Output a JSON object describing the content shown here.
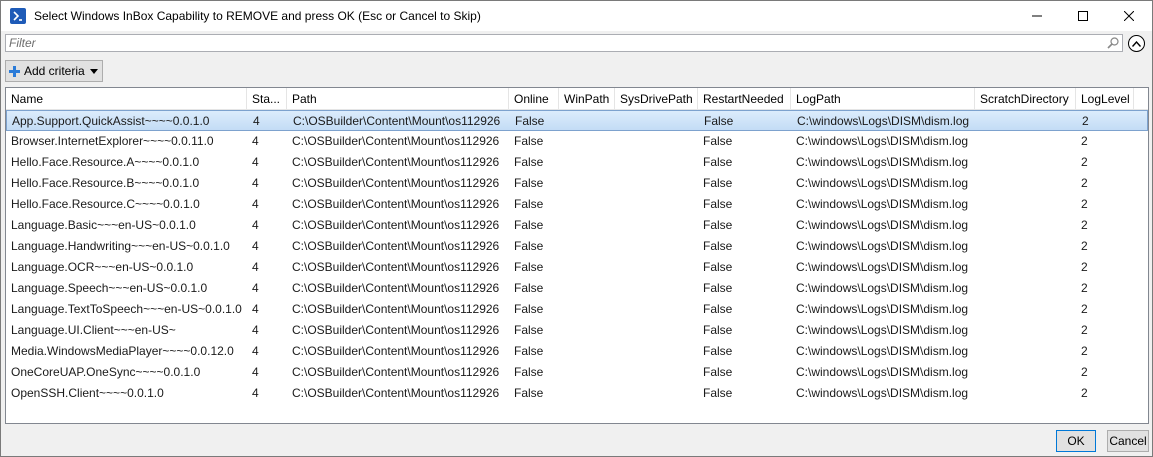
{
  "window": {
    "title": "Select Windows InBox Capability to REMOVE and press OK (Esc or Cancel to Skip)"
  },
  "filter": {
    "placeholder": "Filter"
  },
  "toolbar": {
    "add_criteria_label": "Add criteria"
  },
  "columns": [
    "Name",
    "Sta...",
    "Path",
    "Online",
    "WinPath",
    "SysDrivePath",
    "RestartNeeded",
    "LogPath",
    "ScratchDirectory",
    "LogLevel"
  ],
  "rows": [
    [
      "App.Support.QuickAssist~~~~0.0.1.0",
      "4",
      "C:\\OSBuilder\\Content\\Mount\\os112926",
      "False",
      "",
      "",
      "False",
      "C:\\windows\\Logs\\DISM\\dism.log",
      "",
      "2"
    ],
    [
      "Browser.InternetExplorer~~~~0.0.11.0",
      "4",
      "C:\\OSBuilder\\Content\\Mount\\os112926",
      "False",
      "",
      "",
      "False",
      "C:\\windows\\Logs\\DISM\\dism.log",
      "",
      "2"
    ],
    [
      "Hello.Face.Resource.A~~~~0.0.1.0",
      "4",
      "C:\\OSBuilder\\Content\\Mount\\os112926",
      "False",
      "",
      "",
      "False",
      "C:\\windows\\Logs\\DISM\\dism.log",
      "",
      "2"
    ],
    [
      "Hello.Face.Resource.B~~~~0.0.1.0",
      "4",
      "C:\\OSBuilder\\Content\\Mount\\os112926",
      "False",
      "",
      "",
      "False",
      "C:\\windows\\Logs\\DISM\\dism.log",
      "",
      "2"
    ],
    [
      "Hello.Face.Resource.C~~~~0.0.1.0",
      "4",
      "C:\\OSBuilder\\Content\\Mount\\os112926",
      "False",
      "",
      "",
      "False",
      "C:\\windows\\Logs\\DISM\\dism.log",
      "",
      "2"
    ],
    [
      "Language.Basic~~~en-US~0.0.1.0",
      "4",
      "C:\\OSBuilder\\Content\\Mount\\os112926",
      "False",
      "",
      "",
      "False",
      "C:\\windows\\Logs\\DISM\\dism.log",
      "",
      "2"
    ],
    [
      "Language.Handwriting~~~en-US~0.0.1.0",
      "4",
      "C:\\OSBuilder\\Content\\Mount\\os112926",
      "False",
      "",
      "",
      "False",
      "C:\\windows\\Logs\\DISM\\dism.log",
      "",
      "2"
    ],
    [
      "Language.OCR~~~en-US~0.0.1.0",
      "4",
      "C:\\OSBuilder\\Content\\Mount\\os112926",
      "False",
      "",
      "",
      "False",
      "C:\\windows\\Logs\\DISM\\dism.log",
      "",
      "2"
    ],
    [
      "Language.Speech~~~en-US~0.0.1.0",
      "4",
      "C:\\OSBuilder\\Content\\Mount\\os112926",
      "False",
      "",
      "",
      "False",
      "C:\\windows\\Logs\\DISM\\dism.log",
      "",
      "2"
    ],
    [
      "Language.TextToSpeech~~~en-US~0.0.1.0",
      "4",
      "C:\\OSBuilder\\Content\\Mount\\os112926",
      "False",
      "",
      "",
      "False",
      "C:\\windows\\Logs\\DISM\\dism.log",
      "",
      "2"
    ],
    [
      "Language.UI.Client~~~en-US~",
      "4",
      "C:\\OSBuilder\\Content\\Mount\\os112926",
      "False",
      "",
      "",
      "False",
      "C:\\windows\\Logs\\DISM\\dism.log",
      "",
      "2"
    ],
    [
      "Media.WindowsMediaPlayer~~~~0.0.12.0",
      "4",
      "C:\\OSBuilder\\Content\\Mount\\os112926",
      "False",
      "",
      "",
      "False",
      "C:\\windows\\Logs\\DISM\\dism.log",
      "",
      "2"
    ],
    [
      "OneCoreUAP.OneSync~~~~0.0.1.0",
      "4",
      "C:\\OSBuilder\\Content\\Mount\\os112926",
      "False",
      "",
      "",
      "False",
      "C:\\windows\\Logs\\DISM\\dism.log",
      "",
      "2"
    ],
    [
      "OpenSSH.Client~~~~0.0.1.0",
      "4",
      "C:\\OSBuilder\\Content\\Mount\\os112926",
      "False",
      "",
      "",
      "False",
      "C:\\windows\\Logs\\DISM\\dism.log",
      "",
      "2"
    ]
  ],
  "buttons": {
    "ok": "OK",
    "cancel": "Cancel"
  }
}
